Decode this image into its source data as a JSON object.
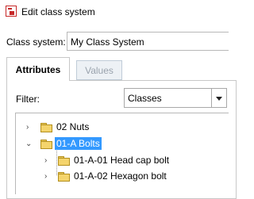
{
  "window": {
    "title": "Edit class system",
    "icon": "class-system-app-icon"
  },
  "form": {
    "class_system_label": "Class system:",
    "class_system_value": "My Class System"
  },
  "tabs": [
    {
      "label": "Attributes",
      "active": true
    },
    {
      "label": "Values",
      "active": false
    }
  ],
  "filter": {
    "label": "Filter:",
    "selected": "Classes"
  },
  "tree": {
    "nodes": [
      {
        "label": "02 Nuts",
        "expanded": false,
        "selected": false
      },
      {
        "label": "01-A Bolts",
        "expanded": true,
        "selected": true,
        "children": [
          {
            "label": "01-A-01 Head cap bolt",
            "expanded": false
          },
          {
            "label": "01-A-02 Hexagon bolt",
            "expanded": false
          }
        ]
      }
    ]
  },
  "colors": {
    "selection": "#3399ff",
    "folder": "#f4d46c",
    "icon_red": "#c62828"
  }
}
